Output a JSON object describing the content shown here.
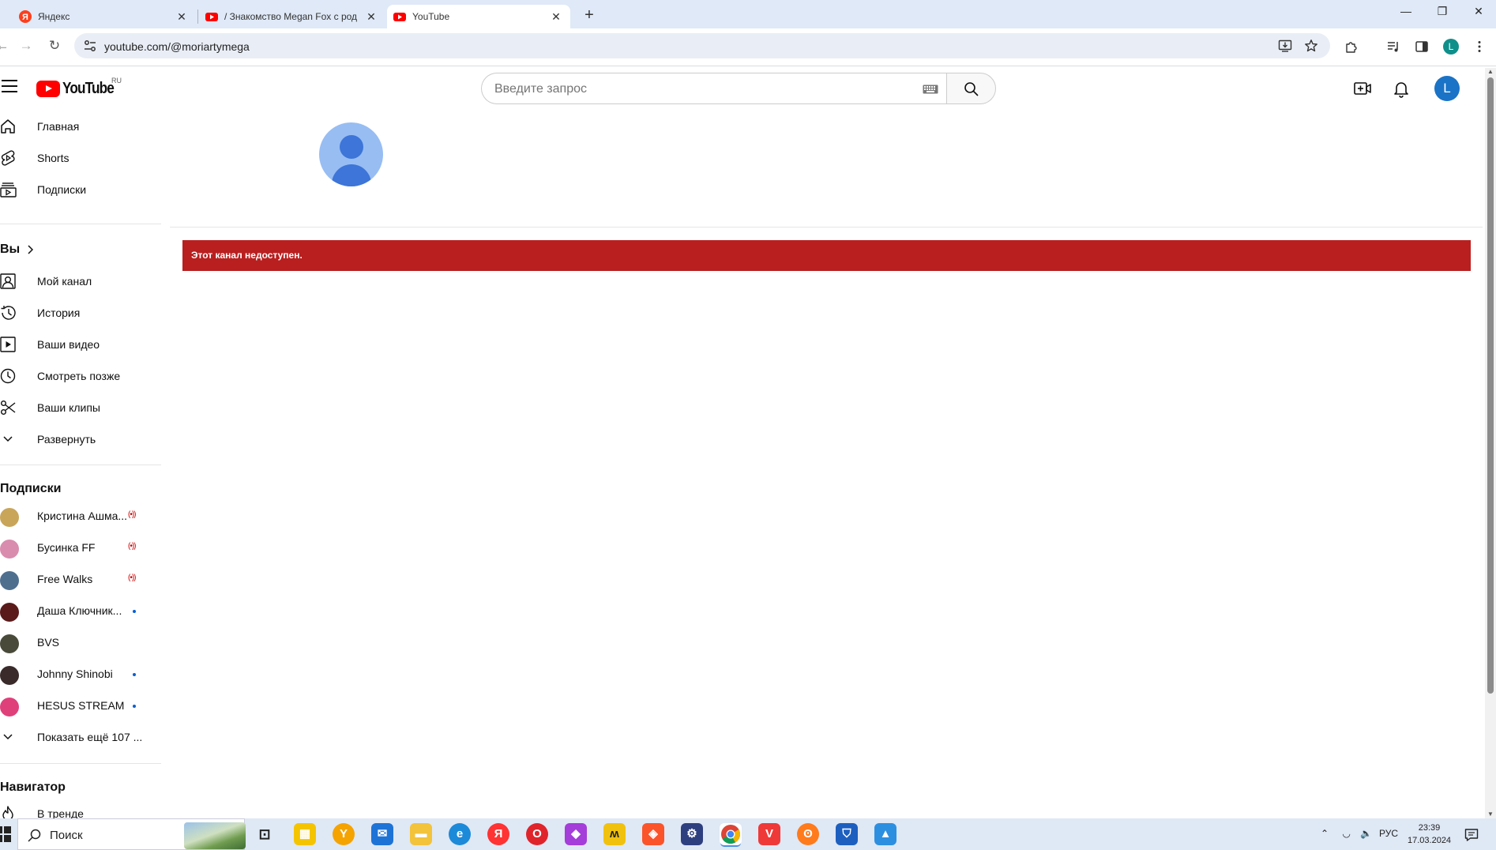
{
  "browser": {
    "tabs": [
      {
        "title": "Яндекс"
      },
      {
        "title": "/ Знакомство Megan Fox с род"
      },
      {
        "title": "YouTube"
      }
    ],
    "url": "youtube.com/@moriartymega",
    "profile_initial": "L"
  },
  "youtube": {
    "region": "RU",
    "search_placeholder": "Введите запрос",
    "avatar_initial": "L"
  },
  "sidebar": {
    "main": [
      {
        "label": "Главная",
        "icon": "home-icon"
      },
      {
        "label": "Shorts",
        "icon": "shorts-icon"
      },
      {
        "label": "Подписки",
        "icon": "subscriptions-icon"
      }
    ],
    "you_heading": "Вы",
    "you": [
      {
        "label": "Мой канал",
        "icon": "my-channel-icon"
      },
      {
        "label": "История",
        "icon": "history-icon"
      },
      {
        "label": "Ваши видео",
        "icon": "your-videos-icon"
      },
      {
        "label": "Смотреть позже",
        "icon": "watch-later-icon"
      },
      {
        "label": "Ваши клипы",
        "icon": "clips-icon"
      },
      {
        "label": "Развернуть",
        "icon": "chevron-down-icon"
      }
    ],
    "subs_heading": "Подписки",
    "subs": [
      {
        "name": "Кристина Ашма...",
        "status": "live",
        "color": "#c9a55a"
      },
      {
        "name": "Бусинка FF",
        "status": "live",
        "color": "#d98cae"
      },
      {
        "name": "Free Walks",
        "status": "live",
        "color": "#4f6f8f"
      },
      {
        "name": "Даша Ключник...",
        "status": "new",
        "color": "#5a1a1a"
      },
      {
        "name": "BVS",
        "status": "",
        "color": "#4a4a3a"
      },
      {
        "name": "Johnny Shinobi",
        "status": "new",
        "color": "#3a2a2a"
      },
      {
        "name": "HESUS STREAM",
        "status": "new",
        "color": "#e0407a"
      }
    ],
    "show_more": "Показать ещё 107 ...",
    "nav_heading": "Навигатор",
    "nav": [
      {
        "label": "В тренде",
        "icon": "trending-icon"
      }
    ]
  },
  "main": {
    "alert": "Этот канал недоступен."
  },
  "taskbar": {
    "search_label": "Поиск",
    "lang": "РУС",
    "time": "23:39",
    "date": "17.03.2024"
  }
}
